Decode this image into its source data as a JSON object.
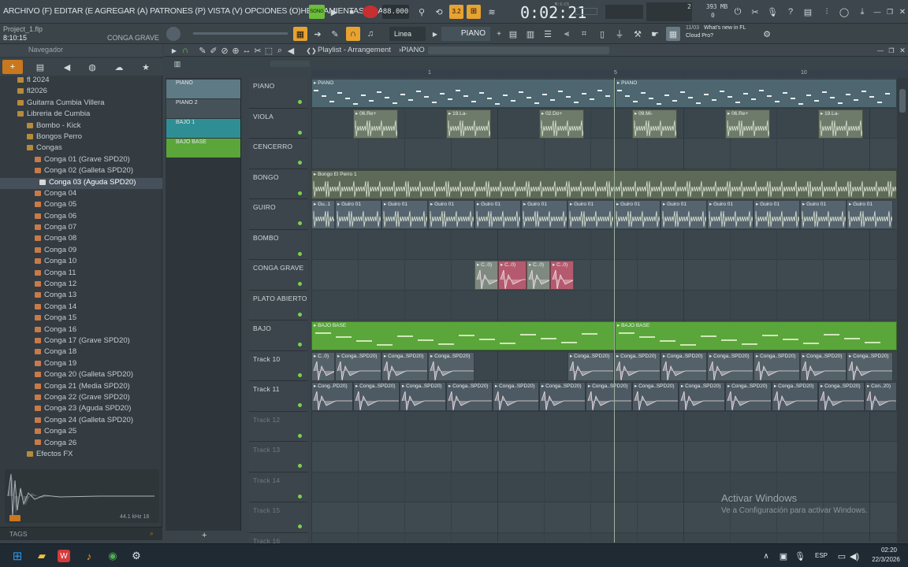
{
  "menu": {
    "text": "ARCHIVO (F) EDITAR (E AGREGAR (A) PATRONES (P) VISTA (V) OPCIONES (O)HERRAMIENTAS (T) AYUDA",
    "hint": "Project_1.flp",
    "position": "8:10:15",
    "hint_target": "CONGA GRAVE"
  },
  "transport": {
    "song_label": "SONG",
    "tempo": "88.000",
    "time": "0:02:21",
    "time_label": "M:S:CS",
    "pattern_label": "3.2",
    "mem": "393 MB",
    "voices": "2",
    "zero": "0"
  },
  "toolbar2": {
    "snap_label": "Linea",
    "pattern_name": "PIANO",
    "news_date": "11/03",
    "news_title": "What's new in FL",
    "news_sub": "Cloud Pro?"
  },
  "browser": {
    "title": "Navegador",
    "items": [
      {
        "label": "fl 2024",
        "indent": 1,
        "kind": "folder"
      },
      {
        "label": "fl2026",
        "indent": 1,
        "kind": "folder"
      },
      {
        "label": "Guitarra Cumbia Villera",
        "indent": 1,
        "kind": "folder"
      },
      {
        "label": "Libreria de Cumbia",
        "indent": 1,
        "kind": "folder"
      },
      {
        "label": "Bombo - Kick",
        "indent": 2,
        "kind": "folder"
      },
      {
        "label": "Bongos Perro",
        "indent": 2,
        "kind": "folder"
      },
      {
        "label": "Congas",
        "indent": 2,
        "kind": "folder"
      },
      {
        "label": "Conga 01 (Grave SPD20)",
        "indent": 3,
        "kind": "file"
      },
      {
        "label": "Conga 02 (Galleta SPD20)",
        "indent": 3,
        "kind": "file"
      },
      {
        "label": "Conga 03 (Aguda SPD20)",
        "indent": 3,
        "kind": "file",
        "selected": true
      },
      {
        "label": "Conga 04",
        "indent": 3,
        "kind": "file"
      },
      {
        "label": "Conga 05",
        "indent": 3,
        "kind": "file"
      },
      {
        "label": "Conga 06",
        "indent": 3,
        "kind": "file"
      },
      {
        "label": "Conga 07",
        "indent": 3,
        "kind": "file"
      },
      {
        "label": "Conga 08",
        "indent": 3,
        "kind": "file"
      },
      {
        "label": "Conga 09",
        "indent": 3,
        "kind": "file"
      },
      {
        "label": "Conga 10",
        "indent": 3,
        "kind": "file"
      },
      {
        "label": "Conga 11",
        "indent": 3,
        "kind": "file"
      },
      {
        "label": "Conga 12",
        "indent": 3,
        "kind": "file"
      },
      {
        "label": "Conga 13",
        "indent": 3,
        "kind": "file"
      },
      {
        "label": "Conga 14",
        "indent": 3,
        "kind": "file"
      },
      {
        "label": "Conga 15",
        "indent": 3,
        "kind": "file"
      },
      {
        "label": "Conga 16",
        "indent": 3,
        "kind": "file"
      },
      {
        "label": "Conga 17 (Grave SPD20)",
        "indent": 3,
        "kind": "file"
      },
      {
        "label": "Conga 18",
        "indent": 3,
        "kind": "file"
      },
      {
        "label": "Conga 19",
        "indent": 3,
        "kind": "file"
      },
      {
        "label": "Conga 20 (Galleta SPD20)",
        "indent": 3,
        "kind": "file"
      },
      {
        "label": "Conga 21 (Media SPD20)",
        "indent": 3,
        "kind": "file"
      },
      {
        "label": "Conga 22 (Grave SPD20)",
        "indent": 3,
        "kind": "file"
      },
      {
        "label": "Conga 23 (Aguda SPD20)",
        "indent": 3,
        "kind": "file"
      },
      {
        "label": "Conga 24 (Galleta SPD20)",
        "indent": 3,
        "kind": "file"
      },
      {
        "label": "Conga 25",
        "indent": 3,
        "kind": "file"
      },
      {
        "label": "Conga 26",
        "indent": 3,
        "kind": "file"
      },
      {
        "label": "Efectos FX",
        "indent": 2,
        "kind": "folder"
      }
    ],
    "sample_info": "44.1 kHz 16",
    "tags_label": "TAGS"
  },
  "playlist": {
    "title": "Playlist - Arrangement",
    "pattern": "PIANO",
    "ruler_marks": [
      "1",
      "5",
      "10"
    ],
    "patterns": [
      {
        "label": "PIANO",
        "color": "#5e7a84"
      },
      {
        "label": "PIANO 2",
        "color": "#46525a"
      },
      {
        "label": "BAJO 1",
        "color": "#2f8e93"
      },
      {
        "label": "BAJO BASE",
        "color": "#5aa63a"
      }
    ],
    "tracks": [
      {
        "name": "PIANO"
      },
      {
        "name": "VIOLA"
      },
      {
        "name": "CENCERRO"
      },
      {
        "name": "BONGO"
      },
      {
        "name": "GUIRO"
      },
      {
        "name": "BOMBO"
      },
      {
        "name": "CONGA GRAVE"
      },
      {
        "name": "PLATO ABIERTO"
      },
      {
        "name": "BAJO"
      },
      {
        "name": "Track 10"
      },
      {
        "name": "Track 11"
      },
      {
        "name": "Track 12",
        "dim": true
      },
      {
        "name": "Track 13",
        "dim": true
      },
      {
        "name": "Track 14",
        "dim": true
      },
      {
        "name": "Track 15",
        "dim": true
      },
      {
        "name": "Track 16",
        "dim": true
      }
    ],
    "clips": {
      "piano": [
        "PIANO",
        "PIANO"
      ],
      "viola": [
        "06.Re+",
        "19.La-",
        "02.Do+",
        "09.Mi-",
        "06.Re+",
        "19.La-"
      ],
      "bongo": "Bongo El Perro 1",
      "guiro_first": "Gu..1",
      "guiro": "Guiro 01",
      "conga_grave": [
        "C..0)",
        "C..0)",
        "C..0)",
        "C..0)"
      ],
      "bajo": [
        "BAJO BASE",
        "BAJO BASE"
      ],
      "t10_first": "C..0)",
      "t10": "Conga..SPD20)",
      "t11_first": "Cong..PD20)",
      "t11": "Conga..SPD20)",
      "t11_last": "Con..20)"
    }
  },
  "watermark": {
    "title": "Activar Windows",
    "sub": "Ve a Configuración para activar Windows."
  },
  "taskbar": {
    "lang": "ESP",
    "time": "02:20",
    "date": "22/3/2026"
  }
}
